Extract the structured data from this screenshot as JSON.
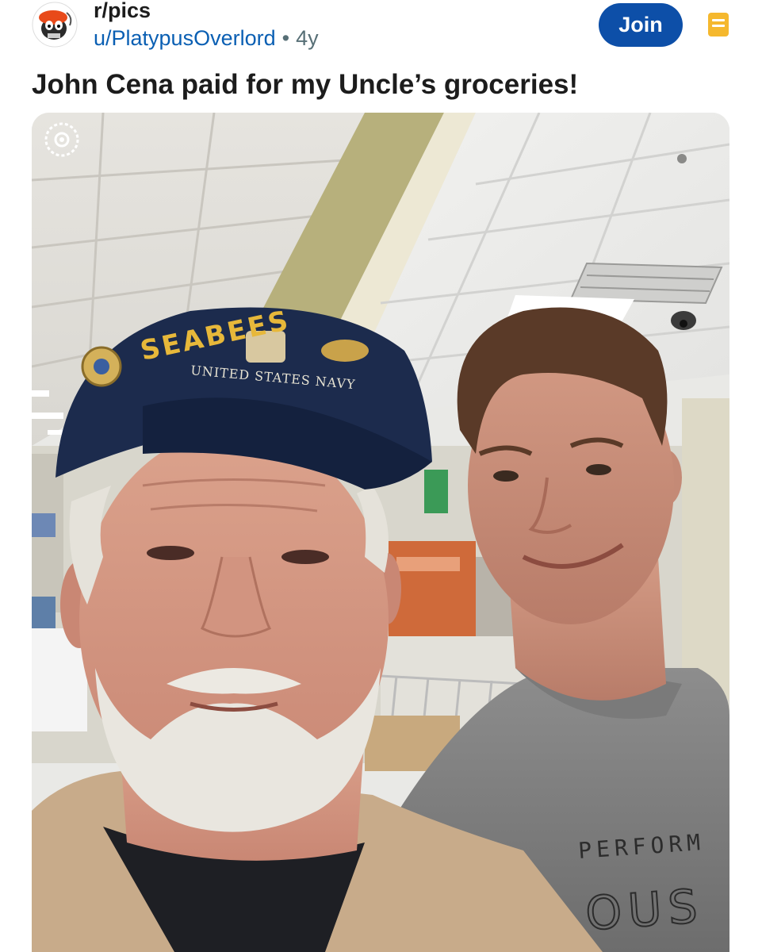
{
  "post": {
    "subreddit": "r/pics",
    "author": "u/PlatypusOverlord",
    "separator": "•",
    "age": "4y",
    "title": "John Cena paid for my Uncle’s groceries!"
  },
  "header": {
    "join_label": "Join"
  },
  "photo": {
    "cap_text_main": "SEABEES",
    "cap_text_sub": "UNITED STATES NAVY",
    "shirt_text_1": "PERFORM",
    "shirt_text_2": "OUS"
  },
  "icons": {
    "avatar": "subreddit-avatar-icon",
    "saved": "saved-icon",
    "camera": "camera-icon"
  },
  "colors": {
    "join_button": "#0d4fa8",
    "author_link": "#0a5fb3",
    "saved_icon": "#f5b82e"
  }
}
